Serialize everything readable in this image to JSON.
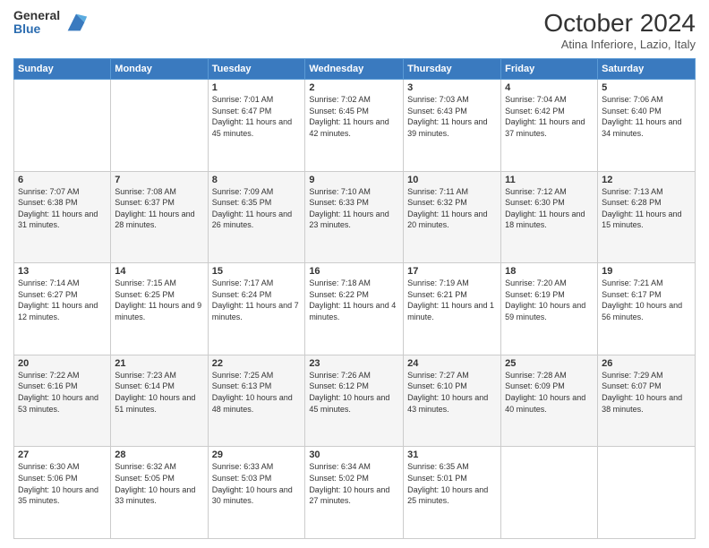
{
  "logo": {
    "general": "General",
    "blue": "Blue"
  },
  "header": {
    "month": "October 2024",
    "location": "Atina Inferiore, Lazio, Italy"
  },
  "weekdays": [
    "Sunday",
    "Monday",
    "Tuesday",
    "Wednesday",
    "Thursday",
    "Friday",
    "Saturday"
  ],
  "weeks": [
    [
      {
        "day": "",
        "sunrise": "",
        "sunset": "",
        "daylight": ""
      },
      {
        "day": "",
        "sunrise": "",
        "sunset": "",
        "daylight": ""
      },
      {
        "day": "1",
        "sunrise": "Sunrise: 7:01 AM",
        "sunset": "Sunset: 6:47 PM",
        "daylight": "Daylight: 11 hours and 45 minutes."
      },
      {
        "day": "2",
        "sunrise": "Sunrise: 7:02 AM",
        "sunset": "Sunset: 6:45 PM",
        "daylight": "Daylight: 11 hours and 42 minutes."
      },
      {
        "day": "3",
        "sunrise": "Sunrise: 7:03 AM",
        "sunset": "Sunset: 6:43 PM",
        "daylight": "Daylight: 11 hours and 39 minutes."
      },
      {
        "day": "4",
        "sunrise": "Sunrise: 7:04 AM",
        "sunset": "Sunset: 6:42 PM",
        "daylight": "Daylight: 11 hours and 37 minutes."
      },
      {
        "day": "5",
        "sunrise": "Sunrise: 7:06 AM",
        "sunset": "Sunset: 6:40 PM",
        "daylight": "Daylight: 11 hours and 34 minutes."
      }
    ],
    [
      {
        "day": "6",
        "sunrise": "Sunrise: 7:07 AM",
        "sunset": "Sunset: 6:38 PM",
        "daylight": "Daylight: 11 hours and 31 minutes."
      },
      {
        "day": "7",
        "sunrise": "Sunrise: 7:08 AM",
        "sunset": "Sunset: 6:37 PM",
        "daylight": "Daylight: 11 hours and 28 minutes."
      },
      {
        "day": "8",
        "sunrise": "Sunrise: 7:09 AM",
        "sunset": "Sunset: 6:35 PM",
        "daylight": "Daylight: 11 hours and 26 minutes."
      },
      {
        "day": "9",
        "sunrise": "Sunrise: 7:10 AM",
        "sunset": "Sunset: 6:33 PM",
        "daylight": "Daylight: 11 hours and 23 minutes."
      },
      {
        "day": "10",
        "sunrise": "Sunrise: 7:11 AM",
        "sunset": "Sunset: 6:32 PM",
        "daylight": "Daylight: 11 hours and 20 minutes."
      },
      {
        "day": "11",
        "sunrise": "Sunrise: 7:12 AM",
        "sunset": "Sunset: 6:30 PM",
        "daylight": "Daylight: 11 hours and 18 minutes."
      },
      {
        "day": "12",
        "sunrise": "Sunrise: 7:13 AM",
        "sunset": "Sunset: 6:28 PM",
        "daylight": "Daylight: 11 hours and 15 minutes."
      }
    ],
    [
      {
        "day": "13",
        "sunrise": "Sunrise: 7:14 AM",
        "sunset": "Sunset: 6:27 PM",
        "daylight": "Daylight: 11 hours and 12 minutes."
      },
      {
        "day": "14",
        "sunrise": "Sunrise: 7:15 AM",
        "sunset": "Sunset: 6:25 PM",
        "daylight": "Daylight: 11 hours and 9 minutes."
      },
      {
        "day": "15",
        "sunrise": "Sunrise: 7:17 AM",
        "sunset": "Sunset: 6:24 PM",
        "daylight": "Daylight: 11 hours and 7 minutes."
      },
      {
        "day": "16",
        "sunrise": "Sunrise: 7:18 AM",
        "sunset": "Sunset: 6:22 PM",
        "daylight": "Daylight: 11 hours and 4 minutes."
      },
      {
        "day": "17",
        "sunrise": "Sunrise: 7:19 AM",
        "sunset": "Sunset: 6:21 PM",
        "daylight": "Daylight: 11 hours and 1 minute."
      },
      {
        "day": "18",
        "sunrise": "Sunrise: 7:20 AM",
        "sunset": "Sunset: 6:19 PM",
        "daylight": "Daylight: 10 hours and 59 minutes."
      },
      {
        "day": "19",
        "sunrise": "Sunrise: 7:21 AM",
        "sunset": "Sunset: 6:17 PM",
        "daylight": "Daylight: 10 hours and 56 minutes."
      }
    ],
    [
      {
        "day": "20",
        "sunrise": "Sunrise: 7:22 AM",
        "sunset": "Sunset: 6:16 PM",
        "daylight": "Daylight: 10 hours and 53 minutes."
      },
      {
        "day": "21",
        "sunrise": "Sunrise: 7:23 AM",
        "sunset": "Sunset: 6:14 PM",
        "daylight": "Daylight: 10 hours and 51 minutes."
      },
      {
        "day": "22",
        "sunrise": "Sunrise: 7:25 AM",
        "sunset": "Sunset: 6:13 PM",
        "daylight": "Daylight: 10 hours and 48 minutes."
      },
      {
        "day": "23",
        "sunrise": "Sunrise: 7:26 AM",
        "sunset": "Sunset: 6:12 PM",
        "daylight": "Daylight: 10 hours and 45 minutes."
      },
      {
        "day": "24",
        "sunrise": "Sunrise: 7:27 AM",
        "sunset": "Sunset: 6:10 PM",
        "daylight": "Daylight: 10 hours and 43 minutes."
      },
      {
        "day": "25",
        "sunrise": "Sunrise: 7:28 AM",
        "sunset": "Sunset: 6:09 PM",
        "daylight": "Daylight: 10 hours and 40 minutes."
      },
      {
        "day": "26",
        "sunrise": "Sunrise: 7:29 AM",
        "sunset": "Sunset: 6:07 PM",
        "daylight": "Daylight: 10 hours and 38 minutes."
      }
    ],
    [
      {
        "day": "27",
        "sunrise": "Sunrise: 6:30 AM",
        "sunset": "Sunset: 5:06 PM",
        "daylight": "Daylight: 10 hours and 35 minutes."
      },
      {
        "day": "28",
        "sunrise": "Sunrise: 6:32 AM",
        "sunset": "Sunset: 5:05 PM",
        "daylight": "Daylight: 10 hours and 33 minutes."
      },
      {
        "day": "29",
        "sunrise": "Sunrise: 6:33 AM",
        "sunset": "Sunset: 5:03 PM",
        "daylight": "Daylight: 10 hours and 30 minutes."
      },
      {
        "day": "30",
        "sunrise": "Sunrise: 6:34 AM",
        "sunset": "Sunset: 5:02 PM",
        "daylight": "Daylight: 10 hours and 27 minutes."
      },
      {
        "day": "31",
        "sunrise": "Sunrise: 6:35 AM",
        "sunset": "Sunset: 5:01 PM",
        "daylight": "Daylight: 10 hours and 25 minutes."
      },
      {
        "day": "",
        "sunrise": "",
        "sunset": "",
        "daylight": ""
      },
      {
        "day": "",
        "sunrise": "",
        "sunset": "",
        "daylight": ""
      }
    ]
  ]
}
